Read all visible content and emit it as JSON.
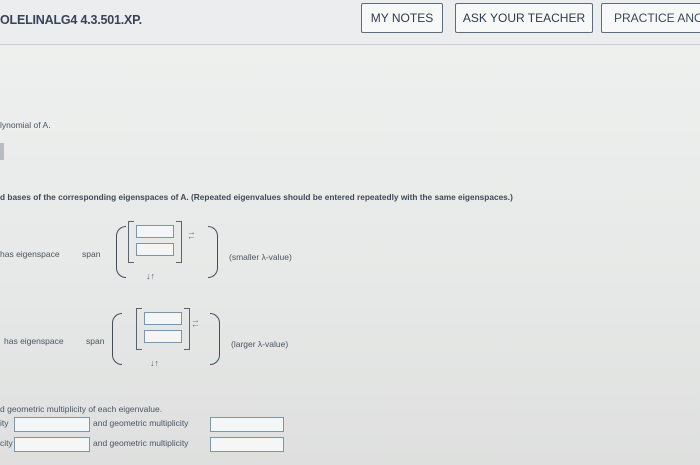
{
  "header": {
    "assignment_id": "OLELINALG4 4.3.501.XP.",
    "buttons": {
      "my_notes": "MY NOTES",
      "ask_teacher": "ASK YOUR TEACHER",
      "practice": "PRACTICE ANO"
    }
  },
  "question": {
    "polynomial_text": "lynomial of A.",
    "bases_text": "d bases of the corresponding eigenspaces of A. (Repeated eigenvalues should be entered repeatedly with the same eigenspaces.)",
    "eig1": {
      "label": "has eigenspace",
      "span": "span",
      "hint": "(smaller λ-value)"
    },
    "eig2": {
      "label": "has eigenspace",
      "span": "span",
      "hint": "(larger λ-value)"
    },
    "multiplicity_text": "d geometric multiplicity of each eigenvalue.",
    "mult_row1": {
      "left_label": "ity",
      "mid_label": "and geometric multiplicity"
    },
    "mult_row2": {
      "left_label": "city",
      "mid_label": "and geometric multiplicity"
    }
  },
  "icons": {
    "vector_arrows": "↓↑",
    "side_arrows": "↑↓"
  }
}
